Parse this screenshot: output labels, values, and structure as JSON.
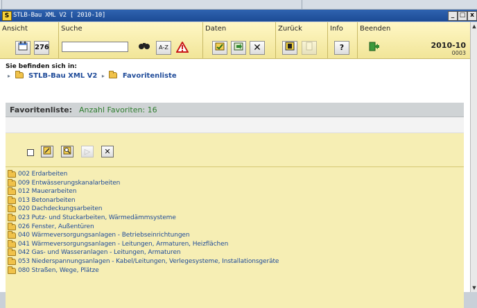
{
  "window": {
    "title": "STLB-Bau XML V2 [ 2010-10]",
    "app_icon_letter": "S",
    "controls": [
      "_",
      "□",
      "x"
    ]
  },
  "toolbar": {
    "groups": [
      {
        "label": "Ansicht"
      },
      {
        "label": "Suche"
      },
      {
        "label": "Daten"
      },
      {
        "label": "Zurück"
      },
      {
        "label": "Info"
      },
      {
        "label": "Beenden"
      }
    ],
    "ansicht_btn2": "276",
    "search": {
      "value": "",
      "placeholder": ""
    },
    "az_label": "A-Z",
    "help_label": "?",
    "version": "2010-10",
    "version_sub": "0003"
  },
  "location": {
    "label": "Sie befinden sich in:",
    "crumbs": [
      "STLB-Bau XML V2",
      "Favoritenliste"
    ]
  },
  "favorites": {
    "title": "Favoritenliste:",
    "count_text": "Anzahl Favoriten: 16",
    "items": [
      "002 Erdarbeiten",
      "009 Entwässerungskanalarbeiten",
      "012 Mauerarbeiten",
      "013 Betonarbeiten",
      "020 Dachdeckungsarbeiten",
      "023 Putz- und Stuckarbeiten, Wärmedämmsysteme",
      "026 Fenster, Außentüren",
      "040 Wärmeversorgungsanlagen - Betriebseinrichtungen",
      "041 Wärmeversorgungsanlagen - Leitungen, Armaturen, Heizflächen",
      "042 Gas- und Wasseranlagen - Leitungen, Armaturen",
      "053 Niederspannungsanlagen - Kabel/Leitungen, Verlegesysteme, Installationsgeräte",
      "080 Straßen, Wege, Plätze"
    ]
  },
  "colors": {
    "titlebar": "#1c4b95",
    "toolbar": "#f1e598",
    "link": "#1f4b99",
    "count": "#2f7d2f",
    "panel": "#f6eeb4"
  }
}
